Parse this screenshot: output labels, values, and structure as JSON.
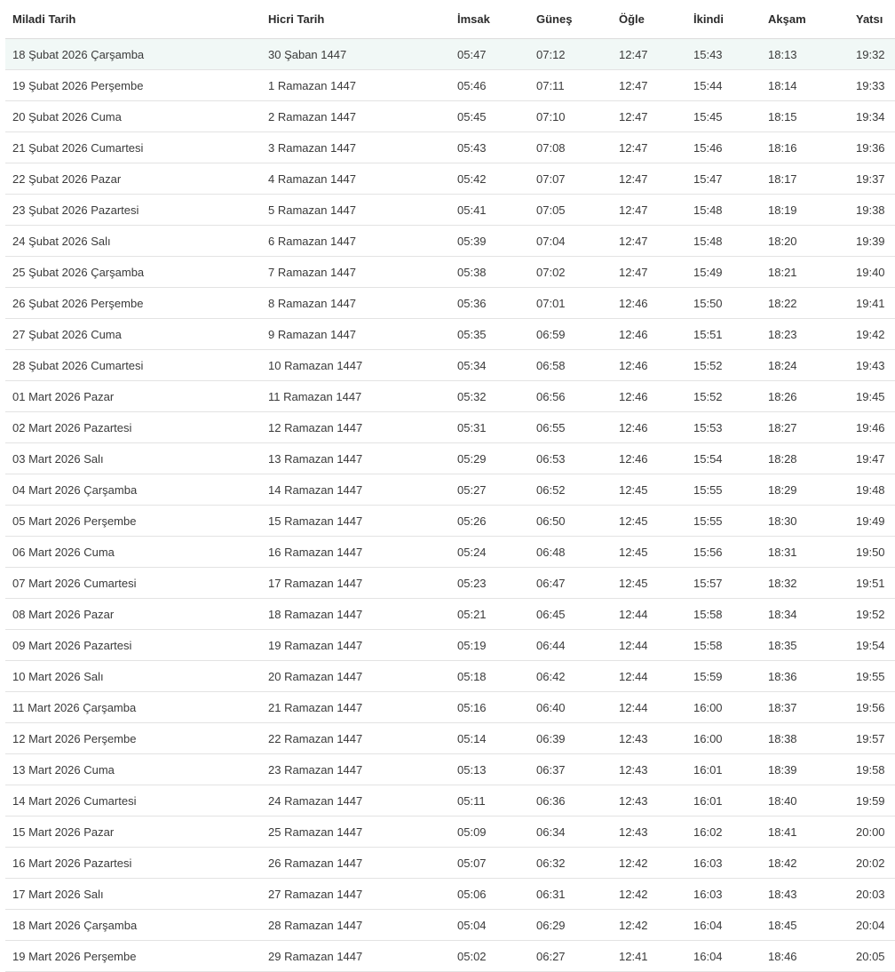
{
  "table": {
    "headers": [
      "Miladi Tarih",
      "Hicri Tarih",
      "İmsak",
      "Güneş",
      "Öğle",
      "İkindi",
      "Akşam",
      "Yatsı"
    ],
    "rows": [
      [
        "18 Şubat 2026 Çarşamba",
        "30 Şaban 1447",
        "05:47",
        "07:12",
        "12:47",
        "15:43",
        "18:13",
        "19:32"
      ],
      [
        "19 Şubat 2026 Perşembe",
        "1 Ramazan 1447",
        "05:46",
        "07:11",
        "12:47",
        "15:44",
        "18:14",
        "19:33"
      ],
      [
        "20 Şubat 2026 Cuma",
        "2 Ramazan 1447",
        "05:45",
        "07:10",
        "12:47",
        "15:45",
        "18:15",
        "19:34"
      ],
      [
        "21 Şubat 2026 Cumartesi",
        "3 Ramazan 1447",
        "05:43",
        "07:08",
        "12:47",
        "15:46",
        "18:16",
        "19:36"
      ],
      [
        "22 Şubat 2026 Pazar",
        "4 Ramazan 1447",
        "05:42",
        "07:07",
        "12:47",
        "15:47",
        "18:17",
        "19:37"
      ],
      [
        "23 Şubat 2026 Pazartesi",
        "5 Ramazan 1447",
        "05:41",
        "07:05",
        "12:47",
        "15:48",
        "18:19",
        "19:38"
      ],
      [
        "24 Şubat 2026 Salı",
        "6 Ramazan 1447",
        "05:39",
        "07:04",
        "12:47",
        "15:48",
        "18:20",
        "19:39"
      ],
      [
        "25 Şubat 2026 Çarşamba",
        "7 Ramazan 1447",
        "05:38",
        "07:02",
        "12:47",
        "15:49",
        "18:21",
        "19:40"
      ],
      [
        "26 Şubat 2026 Perşembe",
        "8 Ramazan 1447",
        "05:36",
        "07:01",
        "12:46",
        "15:50",
        "18:22",
        "19:41"
      ],
      [
        "27 Şubat 2026 Cuma",
        "9 Ramazan 1447",
        "05:35",
        "06:59",
        "12:46",
        "15:51",
        "18:23",
        "19:42"
      ],
      [
        "28 Şubat 2026 Cumartesi",
        "10 Ramazan 1447",
        "05:34",
        "06:58",
        "12:46",
        "15:52",
        "18:24",
        "19:43"
      ],
      [
        "01 Mart 2026 Pazar",
        "11 Ramazan 1447",
        "05:32",
        "06:56",
        "12:46",
        "15:52",
        "18:26",
        "19:45"
      ],
      [
        "02 Mart 2026 Pazartesi",
        "12 Ramazan 1447",
        "05:31",
        "06:55",
        "12:46",
        "15:53",
        "18:27",
        "19:46"
      ],
      [
        "03 Mart 2026 Salı",
        "13 Ramazan 1447",
        "05:29",
        "06:53",
        "12:46",
        "15:54",
        "18:28",
        "19:47"
      ],
      [
        "04 Mart 2026 Çarşamba",
        "14 Ramazan 1447",
        "05:27",
        "06:52",
        "12:45",
        "15:55",
        "18:29",
        "19:48"
      ],
      [
        "05 Mart 2026 Perşembe",
        "15 Ramazan 1447",
        "05:26",
        "06:50",
        "12:45",
        "15:55",
        "18:30",
        "19:49"
      ],
      [
        "06 Mart 2026 Cuma",
        "16 Ramazan 1447",
        "05:24",
        "06:48",
        "12:45",
        "15:56",
        "18:31",
        "19:50"
      ],
      [
        "07 Mart 2026 Cumartesi",
        "17 Ramazan 1447",
        "05:23",
        "06:47",
        "12:45",
        "15:57",
        "18:32",
        "19:51"
      ],
      [
        "08 Mart 2026 Pazar",
        "18 Ramazan 1447",
        "05:21",
        "06:45",
        "12:44",
        "15:58",
        "18:34",
        "19:52"
      ],
      [
        "09 Mart 2026 Pazartesi",
        "19 Ramazan 1447",
        "05:19",
        "06:44",
        "12:44",
        "15:58",
        "18:35",
        "19:54"
      ],
      [
        "10 Mart 2026 Salı",
        "20 Ramazan 1447",
        "05:18",
        "06:42",
        "12:44",
        "15:59",
        "18:36",
        "19:55"
      ],
      [
        "11 Mart 2026 Çarşamba",
        "21 Ramazan 1447",
        "05:16",
        "06:40",
        "12:44",
        "16:00",
        "18:37",
        "19:56"
      ],
      [
        "12 Mart 2026 Perşembe",
        "22 Ramazan 1447",
        "05:14",
        "06:39",
        "12:43",
        "16:00",
        "18:38",
        "19:57"
      ],
      [
        "13 Mart 2026 Cuma",
        "23 Ramazan 1447",
        "05:13",
        "06:37",
        "12:43",
        "16:01",
        "18:39",
        "19:58"
      ],
      [
        "14 Mart 2026 Cumartesi",
        "24 Ramazan 1447",
        "05:11",
        "06:36",
        "12:43",
        "16:01",
        "18:40",
        "19:59"
      ],
      [
        "15 Mart 2026 Pazar",
        "25 Ramazan 1447",
        "05:09",
        "06:34",
        "12:43",
        "16:02",
        "18:41",
        "20:00"
      ],
      [
        "16 Mart 2026 Pazartesi",
        "26 Ramazan 1447",
        "05:07",
        "06:32",
        "12:42",
        "16:03",
        "18:42",
        "20:02"
      ],
      [
        "17 Mart 2026 Salı",
        "27 Ramazan 1447",
        "05:06",
        "06:31",
        "12:42",
        "16:03",
        "18:43",
        "20:03"
      ],
      [
        "18 Mart 2026 Çarşamba",
        "28 Ramazan 1447",
        "05:04",
        "06:29",
        "12:42",
        "16:04",
        "18:45",
        "20:04"
      ],
      [
        "19 Mart 2026 Perşembe",
        "29 Ramazan 1447",
        "05:02",
        "06:27",
        "12:41",
        "16:04",
        "18:46",
        "20:05"
      ]
    ]
  },
  "colors": {
    "highlight_row_bg": "#f1f8f6",
    "text": "#3a3a3a",
    "header_text": "#2b2b2b",
    "divider": "#e3e3e3"
  }
}
